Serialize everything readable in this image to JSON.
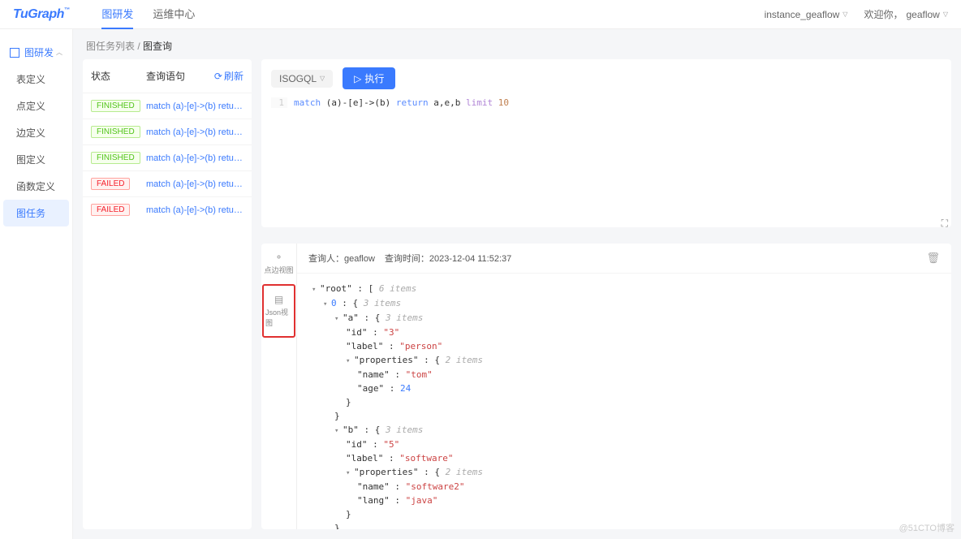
{
  "header": {
    "logo": "TuGraph",
    "tabs": [
      {
        "label": "图研发",
        "active": true
      },
      {
        "label": "运维中心",
        "active": false
      }
    ],
    "instance_label": "instance_geaflow",
    "welcome": "欢迎你，",
    "user": "geaflow"
  },
  "sidebar": {
    "section": "图研发",
    "items": [
      {
        "label": "表定义"
      },
      {
        "label": "点定义"
      },
      {
        "label": "边定义"
      },
      {
        "label": "图定义"
      },
      {
        "label": "函数定义"
      },
      {
        "label": "图任务",
        "active": true
      }
    ]
  },
  "breadcrumb": {
    "parent": "图任务列表",
    "sep": "/",
    "current": "图查询"
  },
  "task_panel": {
    "col_status": "状态",
    "col_query": "查询语句",
    "refresh": "刷新",
    "rows": [
      {
        "status": "FINISHED",
        "status_class": "finished",
        "query": "match (a)-[e]->(b) retur..."
      },
      {
        "status": "FINISHED",
        "status_class": "finished",
        "query": "match (a)-[e]->(b) retur..."
      },
      {
        "status": "FINISHED",
        "status_class": "finished",
        "query": "match (a)-[e]->(b) retur..."
      },
      {
        "status": "FAILED",
        "status_class": "failed",
        "query": "match (a)-[e]->(b) retur..."
      },
      {
        "status": "FAILED",
        "status_class": "failed",
        "query": "match (a)-[e]->(b) retur..."
      }
    ]
  },
  "query": {
    "lang": "ISOGQL",
    "run": "执行",
    "code_kw1": "match",
    "code_expr": " (a)-[e]->(b) ",
    "code_kw2": "return",
    "code_args": " a,e,b ",
    "code_kw3": "limit",
    "code_num": " 10"
  },
  "views": {
    "graph": "点边视图",
    "json": "Json视图"
  },
  "result": {
    "queried_by_label": "查询人：",
    "queried_by": "geaflow",
    "time_label": "查询时间：",
    "time": "2023-12-04 11:52:37",
    "json": {
      "root_key": "\"root\"",
      "root_open": "[",
      "root_meta": "6 items",
      "idx0_key": "0",
      "idx0_open": "{",
      "idx0_meta": "3 items",
      "a_key": "\"a\"",
      "a_open": "{",
      "a_meta": "3 items",
      "a_id_key": "\"id\"",
      "a_id_val": "\"3\"",
      "a_label_key": "\"label\"",
      "a_label_val": "\"person\"",
      "a_props_key": "\"properties\"",
      "a_props_open": "{",
      "a_props_meta": "2 items",
      "a_name_key": "\"name\"",
      "a_name_val": "\"tom\"",
      "a_age_key": "\"age\"",
      "a_age_val": "24",
      "b_key": "\"b\"",
      "b_open": "{",
      "b_meta": "3 items",
      "b_id_key": "\"id\"",
      "b_id_val": "\"5\"",
      "b_label_key": "\"label\"",
      "b_label_val": "\"software\"",
      "b_props_key": "\"properties\"",
      "b_props_open": "{",
      "b_props_meta": "2 items",
      "b_name_key": "\"name\"",
      "b_name_val": "\"software2\"",
      "b_lang_key": "\"lang\"",
      "b_lang_val": "\"java\"",
      "close": "}"
    }
  },
  "watermark": "@51CTO博客"
}
